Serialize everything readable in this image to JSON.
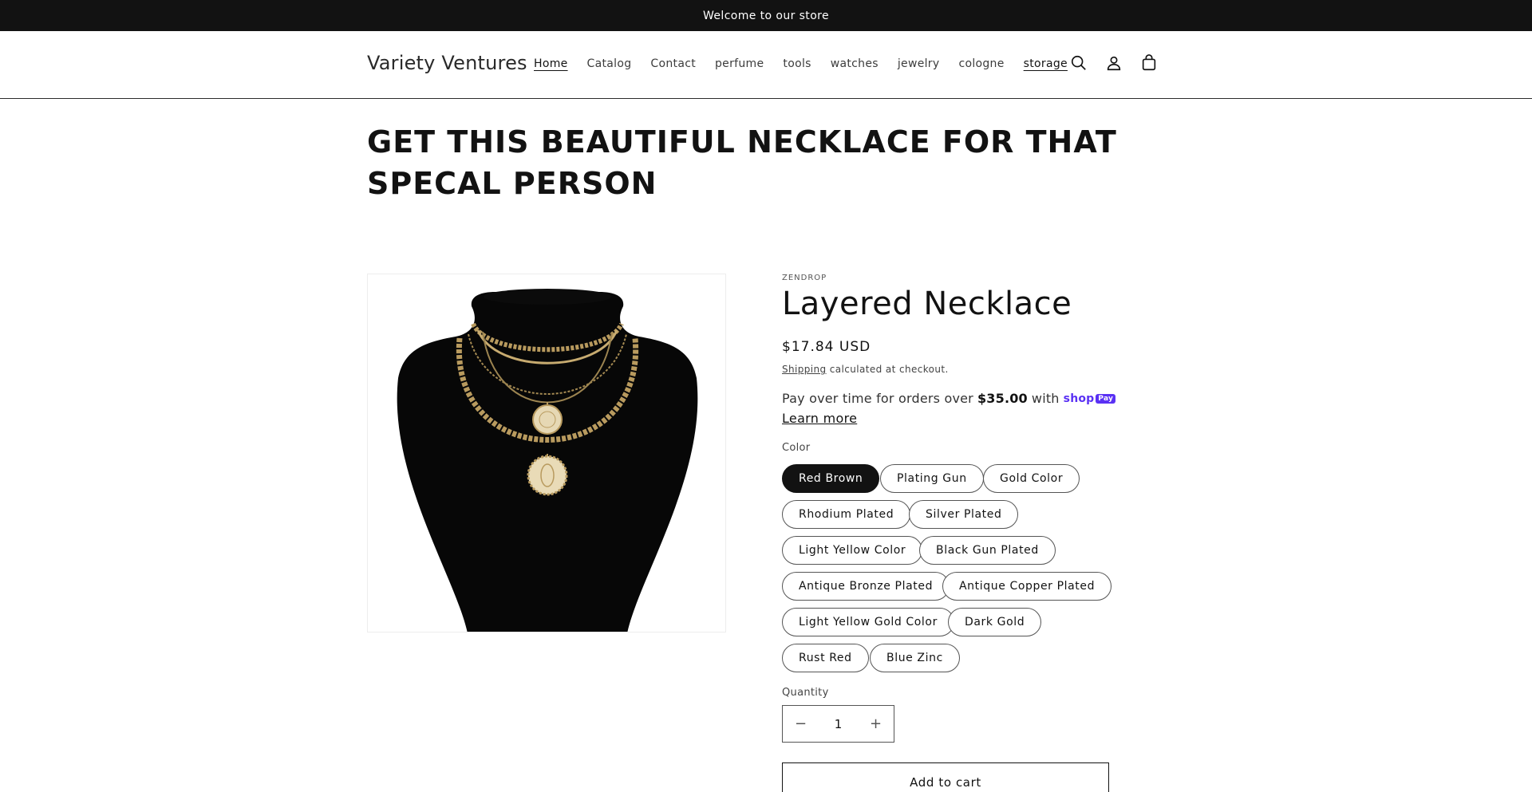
{
  "announcement": {
    "text": "Welcome to our store"
  },
  "header": {
    "logo": "Variety Ventures",
    "nav": [
      {
        "label": "Home"
      },
      {
        "label": "Catalog"
      },
      {
        "label": "Contact"
      },
      {
        "label": "perfume"
      },
      {
        "label": "tools"
      },
      {
        "label": "watches"
      },
      {
        "label": "jewelry"
      },
      {
        "label": "cologne"
      },
      {
        "label": "storage"
      }
    ],
    "icons": [
      "search-icon",
      "account-icon",
      "cart-icon"
    ]
  },
  "page": {
    "heading": "GET THIS BEAUTIFUL NECKLACE FOR THAT SPECAL PERSON"
  },
  "product": {
    "vendor": "ZENDROP",
    "title": "Layered Necklace",
    "price": "$17.84 USD",
    "shipping_link": "Shipping",
    "shipping_text": " calculated at checkout.",
    "installments_prefix": "Pay over time for orders over",
    "installments_amount": "$35.00",
    "installments_with": "with",
    "shoppay_label": "shop",
    "shoppay_badge": "Pay",
    "learn_more": "Learn more",
    "color_label": "Color",
    "colors": [
      {
        "label": "Red Brown",
        "selected": true
      },
      {
        "label": "Plating Gun"
      },
      {
        "label": "Gold Color"
      },
      {
        "label": "Rhodium Plated"
      },
      {
        "label": "Silver Plated"
      },
      {
        "label": "Light Yellow Color"
      },
      {
        "label": "Black Gun Plated"
      },
      {
        "label": "Antique Bronze Plated"
      },
      {
        "label": "Antique Copper Plated"
      },
      {
        "label": "Light Yellow Gold Color"
      },
      {
        "label": "Dark Gold"
      },
      {
        "label": "Rust Red"
      },
      {
        "label": "Blue Zinc"
      }
    ],
    "quantity_label": "Quantity",
    "quantity_value": "1",
    "add_to_cart": "Add to cart"
  },
  "colors": {
    "dark": "#121212",
    "accent_shoppay": "#5a31f4"
  }
}
